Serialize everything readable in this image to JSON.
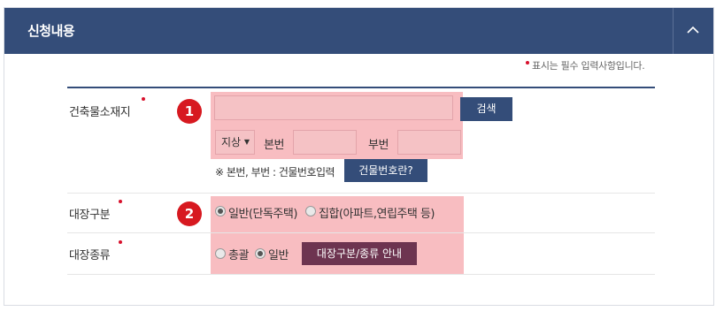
{
  "header": {
    "title": "신청내용",
    "collapse_icon": "chevron-up-icon"
  },
  "required_note": "표시는 필수 입력사항입니다.",
  "location": {
    "label": "건축물소재지",
    "address_value": "",
    "search_button": "검색",
    "land_type_selected": "지상",
    "main_number_label": "본번",
    "main_number_value": "",
    "sub_number_label": "부번",
    "sub_number_value": "",
    "hint": "※ 본번, 부번 : 건물번호입력",
    "building_number_button": "건물번호란?"
  },
  "register_type": {
    "label": "대장구분",
    "options": [
      "일반(단독주택)",
      "집합(아파트,연립주택 등)"
    ],
    "selected_index": 0
  },
  "register_kind": {
    "label": "대장종류",
    "options": [
      "총괄",
      "일반"
    ],
    "selected_index": 1,
    "guide_button": "대장구분/종류 안내"
  },
  "annotations": {
    "badge_1": "1",
    "badge_2": "2"
  },
  "colors": {
    "header": "#344d79",
    "required": "#d8102c",
    "badge": "#d71920",
    "highlight": "#f4949b",
    "guide_button": "#6d3450"
  }
}
